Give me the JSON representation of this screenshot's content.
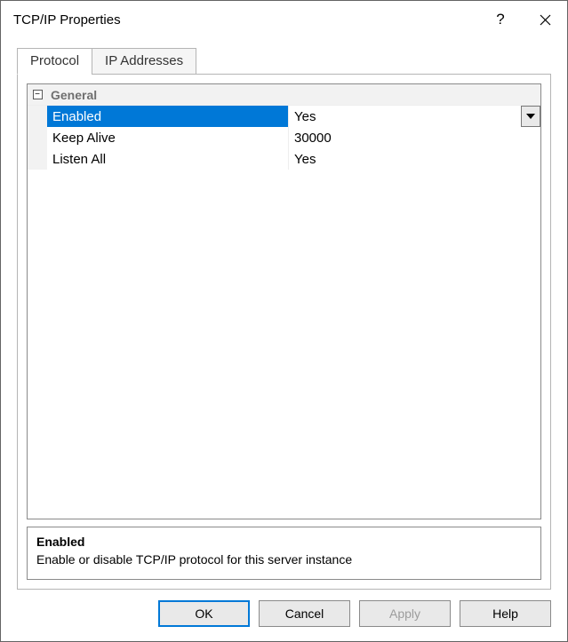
{
  "window": {
    "title": "TCP/IP Properties"
  },
  "tabs": {
    "protocol": "Protocol",
    "ip_addresses": "IP Addresses"
  },
  "grid": {
    "category": "General",
    "rows": {
      "enabled": {
        "label": "Enabled",
        "value": "Yes"
      },
      "keep_alive": {
        "label": "Keep Alive",
        "value": "30000"
      },
      "listen_all": {
        "label": "Listen All",
        "value": "Yes"
      }
    }
  },
  "description": {
    "title": "Enabled",
    "text": "Enable or disable TCP/IP protocol for this server instance"
  },
  "buttons": {
    "ok": "OK",
    "cancel": "Cancel",
    "apply": "Apply",
    "help": "Help"
  },
  "glyphs": {
    "help": "?",
    "collapse": "−"
  }
}
